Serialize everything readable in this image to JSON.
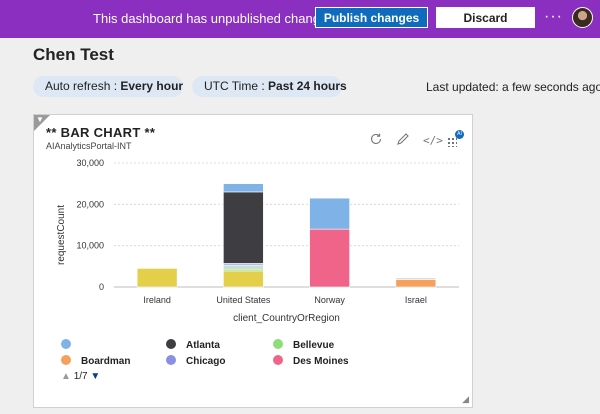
{
  "banner": {
    "message": "This dashboard has unpublished changes.",
    "publish_label": "Publish changes",
    "discard_label": "Discard",
    "more_icon": "more-icon",
    "bg_color": "#8a2fc0"
  },
  "page": {
    "title": "Chen Test",
    "auto_refresh_label": "Auto refresh : ",
    "auto_refresh_value": "Every hour",
    "time_label": "UTC Time : ",
    "time_value": "Past 24 hours",
    "last_updated": "Last updated: a few seconds ago"
  },
  "card": {
    "title": "** BAR CHART **",
    "subtitle": "AIAnalyticsPortal-INT",
    "pin_badge": "AI",
    "tools": [
      "refresh-icon",
      "edit-icon",
      "code-icon",
      "pin-to-dashboard-icon"
    ]
  },
  "chart_data": {
    "type": "bar",
    "stacked": true,
    "categories": [
      "Ireland",
      "United States",
      "Norway",
      "Israel"
    ],
    "xlabel": "client_CountryOrRegion",
    "ylabel": "requestCount",
    "ylim": [
      0,
      30000
    ],
    "yticks": [
      "0",
      "10,000",
      "20,000",
      "30,000"
    ],
    "ytick_values": [
      0,
      10000,
      20000,
      30000
    ],
    "series": [
      {
        "name": "",
        "color": "#e3cf4a",
        "values": [
          4500,
          3900,
          0,
          0
        ]
      },
      {
        "name": "Bellevue",
        "color": "#8fdc7a",
        "values": [
          0,
          400,
          0,
          0
        ]
      },
      {
        "name": "",
        "color": "#c8ded8",
        "values": [
          0,
          1000,
          0,
          0
        ]
      },
      {
        "name": "Chicago",
        "color": "#a4a8e2",
        "values": [
          0,
          400,
          0,
          0
        ]
      },
      {
        "name": "Des Moines",
        "color": "#f0648a",
        "values": [
          0,
          0,
          14000,
          0
        ]
      },
      {
        "name": "Boardman",
        "color": "#f5a05c",
        "values": [
          0,
          0,
          0,
          1800
        ]
      },
      {
        "name": "",
        "color": "#e0d2c8",
        "values": [
          0,
          0,
          0,
          400
        ]
      },
      {
        "name": "Atlanta",
        "color": "#3d3d42",
        "values": [
          0,
          17300,
          0,
          0
        ]
      },
      {
        "name": "",
        "color": "#7fb3e8",
        "values": [
          0,
          2000,
          7500,
          0
        ]
      }
    ],
    "grid": true,
    "legend_placement": "bottom"
  },
  "legend": {
    "items": [
      {
        "label": "",
        "color": "#7fb3e8"
      },
      {
        "label": "Atlanta",
        "color": "#3d3d42"
      },
      {
        "label": "Bellevue",
        "color": "#8fdc7a"
      },
      {
        "label": "Boardman",
        "color": "#f5a05c"
      },
      {
        "label": "Chicago",
        "color": "#8a8fe0"
      },
      {
        "label": "Des Moines",
        "color": "#f0648a"
      }
    ],
    "page": "1/7"
  }
}
